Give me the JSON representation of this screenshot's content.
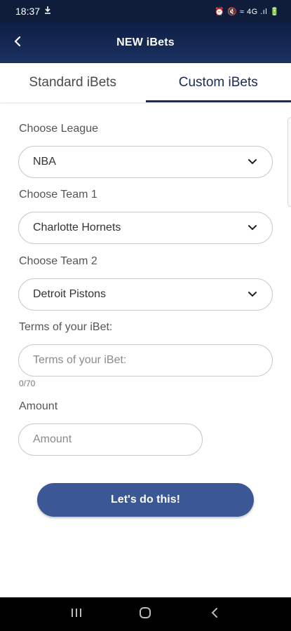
{
  "status_bar": {
    "time": "18:37",
    "right_indicators": "⏰ 🔇 ≈ 4G .ıl 🔋"
  },
  "header": {
    "title": "NEW iBets"
  },
  "tabs": [
    {
      "label": "Standard iBets",
      "active": false
    },
    {
      "label": "Custom iBets",
      "active": true
    }
  ],
  "form": {
    "league": {
      "label": "Choose League",
      "value": "NBA"
    },
    "team1": {
      "label": "Choose Team 1",
      "value": "Charlotte Hornets"
    },
    "team2": {
      "label": "Choose Team 2",
      "value": "Detroit Pistons"
    },
    "terms": {
      "label": "Terms of your iBet:",
      "placeholder": "Terms of your iBet:",
      "counter": "0/70"
    },
    "amount": {
      "label": "Amount",
      "placeholder": "Amount"
    },
    "submit_label": "Let's do this!"
  },
  "colors": {
    "header": "#162a56",
    "accent": "#1c2a52",
    "button": "#3b5795"
  }
}
